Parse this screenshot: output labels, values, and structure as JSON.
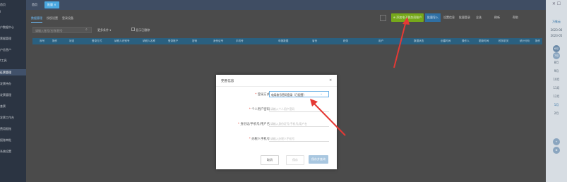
{
  "sidebar": {
    "items": [
      {
        "label": "首页"
      },
      {
        "label": "I"
      },
      {
        "label": "户数据中心"
      },
      {
        "label": "票据管理"
      },
      {
        "label": "户信息户"
      },
      {
        "label": "t工具"
      },
      {
        "label": "征票管理"
      },
      {
        "label": "发票待办"
      },
      {
        "label": "发票管理"
      },
      {
        "label": "查票"
      },
      {
        "label": "发票工作台"
      },
      {
        "label": "费用报账"
      },
      {
        "label": "报账审批"
      },
      {
        "label": "系统设置"
      }
    ]
  },
  "topbar": {
    "tabs": [
      {
        "label": "首页"
      },
      {
        "label": "批量 ×"
      }
    ]
  },
  "subtabs": [
    {
      "label": "数据管理"
    },
    {
      "label": "授权设置"
    },
    {
      "label": "登录设备"
    }
  ],
  "toolbar": {
    "main_button": "⊕ 添加电子税务局账户",
    "mode_button": "批量导入",
    "links": [
      "设置信息",
      "批量登录",
      "全选",
      "刷新",
      "帮助"
    ]
  },
  "search": {
    "placeholder": "请输入账号/名称/税号"
  },
  "filter": {
    "label": "更多条件",
    "checkbox_label": "显示已删除"
  },
  "table": {
    "headers": [
      "序号",
      "操作",
      "状态",
      "登录方式",
      "纳税人识别号",
      "纳税人名称",
      "登录账户",
      "密码",
      "身份证号",
      "手机号",
      "申报数据",
      "省份",
      "税务",
      "用户",
      "数据状态",
      "创建时间",
      "操作人",
      "更新时间",
      "税务机关",
      "统计分析",
      "操作"
    ]
  },
  "right_panel": {
    "title": "万象云",
    "date1": "2023-06",
    "date2": "2023-05",
    "months": [
      "6月",
      "7月",
      "8月",
      "9月",
      "10月",
      "11月",
      "12月",
      "1月",
      "2月"
    ]
  },
  "dialog": {
    "title": "完善信息",
    "close": "×",
    "fields": [
      {
        "label": "登录方式",
        "required": true,
        "value": "电局账号密码登录（已配置）",
        "placeholder": ""
      },
      {
        "label": "个人用户密码",
        "required": true,
        "value": "",
        "placeholder": "请输入个人用户密码"
      },
      {
        "label": "身份证/手机号/用户名",
        "required": true,
        "value": "",
        "placeholder": "请输入身份证号/手机号/用户名"
      },
      {
        "label": "办税人手机号",
        "required": true,
        "value": "",
        "placeholder": "请输入办税人手机号"
      }
    ],
    "buttons": {
      "cancel": "取消",
      "save": "保存",
      "save_query": "保存并查询"
    }
  },
  "colors": {
    "accent_green": "#76a81a",
    "accent_blue": "#4aa7e0",
    "arrow_red": "#e53935"
  }
}
